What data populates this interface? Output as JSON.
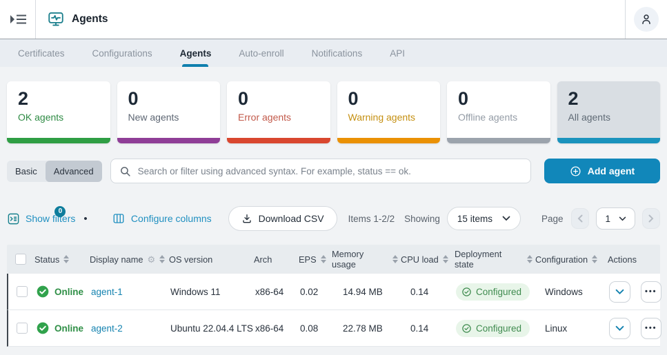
{
  "header": {
    "title": "Agents"
  },
  "tabs": [
    {
      "label": "Certificates"
    },
    {
      "label": "Configurations"
    },
    {
      "label": "Agents"
    },
    {
      "label": "Auto-enroll"
    },
    {
      "label": "Notifications"
    },
    {
      "label": "API"
    }
  ],
  "summary_cards": [
    {
      "count": "2",
      "label": "OK agents",
      "label_color": "#2e8b44",
      "bar_color": "#2f9e44",
      "selected": false
    },
    {
      "count": "0",
      "label": "New agents",
      "label_color": "#5d6673",
      "bar_color": "#8f3e97",
      "selected": false
    },
    {
      "count": "0",
      "label": "Error agents",
      "label_color": "#c2594a",
      "bar_color": "#d9472f",
      "selected": false
    },
    {
      "count": "0",
      "label": "Warning agents",
      "label_color": "#c59012",
      "bar_color": "#ea9104",
      "selected": false
    },
    {
      "count": "0",
      "label": "Offline agents",
      "label_color": "#949ca6",
      "bar_color": "#9ba3ac",
      "selected": false
    },
    {
      "count": "2",
      "label": "All agents",
      "label_color": "#5f6a75",
      "bar_color": "#1a93bd",
      "selected": true
    }
  ],
  "filter_bar": {
    "mode_toggle": {
      "options": [
        "Basic",
        "Advanced"
      ],
      "selected": "Advanced"
    },
    "search_placeholder": "Search or filter using advanced syntax. For example, status == ok.",
    "add_agent_label": "Add agent"
  },
  "toolbar": {
    "show_filters_label": "Show filters",
    "filters_badge": "0",
    "configure_columns_label": "Configure columns",
    "download_csv_label": "Download CSV",
    "items_label": "Items 1-2/2",
    "showing_label": "Showing",
    "page_size_value": "15 items",
    "page_label": "Page",
    "page_number": "1"
  },
  "table": {
    "columns": [
      {
        "label": "Status"
      },
      {
        "label": "Display name"
      },
      {
        "label": "OS version"
      },
      {
        "label": "Arch"
      },
      {
        "label": "EPS"
      },
      {
        "label": "Memory usage"
      },
      {
        "label": "CPU load"
      },
      {
        "label": "Deployment state"
      },
      {
        "label": "Configuration"
      },
      {
        "label": "Actions"
      }
    ],
    "rows": [
      {
        "status": "Online",
        "display_name": "agent-1",
        "os_version": "Windows 11",
        "arch": "x86-64",
        "eps": "0.02",
        "memory_usage": "14.94 MB",
        "cpu_load": "0.14",
        "deployment_state": "Configured",
        "configuration": "Windows"
      },
      {
        "status": "Online",
        "display_name": "agent-2",
        "os_version": "Ubuntu 22.04.4 LTS",
        "arch": "x86-64",
        "eps": "0.08",
        "memory_usage": "22.78 MB",
        "cpu_load": "0.14",
        "deployment_state": "Configured",
        "configuration": "Linux"
      }
    ]
  },
  "icons": {
    "sidebar-toggle-icon": "triangle-with-lines",
    "agents-monitor-icon": "monitor-with-pulse",
    "user-icon": "person-outline",
    "search-icon": "magnifier",
    "add-plus-icon": "plus-in-circle",
    "show-filters-icon": "filter-panel",
    "configure-columns-icon": "columns",
    "download-icon": "arrow-down-tray",
    "sort-icon": "up-down-triangles",
    "column-gear-icon": "gear",
    "status-online-icon": "check-in-filled-circle",
    "configured-check-icon": "check-in-outline-circle",
    "chevron-down-icon": "chevron-down",
    "ellipsis-icon": "three-dots"
  },
  "colors": {
    "accent_blue": "#1187ba",
    "teal_icon": "#1b7f8c",
    "online_green": "#2f8f46",
    "pill_bg": "#e8f5e9",
    "header_divider": "#9aa1a8",
    "tabbar_bg": "#e9edf2",
    "table_header_bg": "#e8ecef"
  }
}
